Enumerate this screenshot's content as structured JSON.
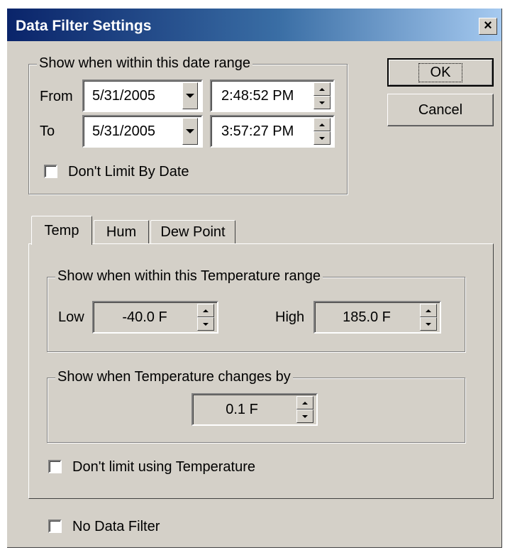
{
  "window": {
    "title": "Data Filter Settings",
    "close_glyph": "×"
  },
  "buttons": {
    "ok": "OK",
    "cancel": "Cancel"
  },
  "date_range": {
    "legend": "Show when within this date range",
    "from_label": "From",
    "to_label": "To",
    "from_date": "5/31/2005",
    "from_time": "2:48:52 PM",
    "to_date": "5/31/2005",
    "to_time": "3:57:27 PM",
    "no_limit_label": "Don't Limit By Date",
    "no_limit_checked": false
  },
  "tabs": [
    {
      "label": "Temp",
      "selected": true
    },
    {
      "label": "Hum",
      "selected": false
    },
    {
      "label": "Dew Point",
      "selected": false
    }
  ],
  "temp_panel": {
    "range_legend": "Show when within this Temperature range",
    "low_label": "Low",
    "low_value": "-40.0 F",
    "high_label": "High",
    "high_value": "185.0 F",
    "change_legend": "Show when Temperature changes by",
    "change_value": "0.1 F",
    "no_limit_label": "Don't limit using Temperature",
    "no_limit_checked": false
  },
  "no_data_filter": {
    "label": "No Data Filter",
    "checked": false
  },
  "colors": {
    "face": "#d4d0c8",
    "title_start": "#0a246a",
    "title_end": "#a6caf0"
  },
  "icons": {
    "close": "close-icon",
    "dropdown": "chevron-down-icon",
    "spin": "spin-up-down-icon"
  }
}
